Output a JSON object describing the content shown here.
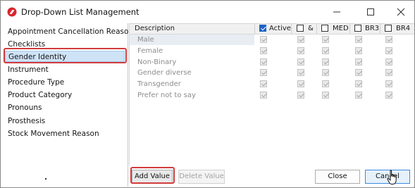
{
  "window": {
    "title": "Drop-Down List Management",
    "icon": "red-app-icon",
    "controls": [
      "minimize-icon",
      "maximize-icon",
      "close-icon"
    ]
  },
  "sidebar": {
    "items": [
      {
        "label": "Appointment Cancellation Reasons",
        "selected": false
      },
      {
        "label": "Checklists",
        "selected": false
      },
      {
        "label": "Gender Identity",
        "selected": true
      },
      {
        "label": "Instrument",
        "selected": false
      },
      {
        "label": "Procedure Type",
        "selected": false
      },
      {
        "label": "Product Category",
        "selected": false
      },
      {
        "label": "Pronouns",
        "selected": false
      },
      {
        "label": "Prosthesis",
        "selected": false
      },
      {
        "label": "Stock Movement Reason",
        "selected": false
      }
    ]
  },
  "grid": {
    "columns": [
      {
        "label": "Description",
        "checkbox": false
      },
      {
        "label": "Active",
        "checkbox": true,
        "checked": true
      },
      {
        "label": "&",
        "checkbox": true,
        "checked": false
      },
      {
        "label": "MED",
        "checkbox": true,
        "checked": false
      },
      {
        "label": "BR3",
        "checkbox": true,
        "checked": false
      },
      {
        "label": "BR4",
        "checkbox": true,
        "checked": false
      }
    ],
    "rows": [
      {
        "description": "Male",
        "checks": [
          true,
          true,
          true,
          true,
          true
        ]
      },
      {
        "description": "Female",
        "checks": [
          true,
          true,
          true,
          true,
          true
        ]
      },
      {
        "description": "Non-Binary",
        "checks": [
          true,
          true,
          true,
          true,
          true
        ]
      },
      {
        "description": "Gender diverse",
        "checks": [
          true,
          true,
          true,
          true,
          true
        ]
      },
      {
        "description": "Transgender",
        "checks": [
          true,
          true,
          true,
          true,
          true
        ]
      },
      {
        "description": "Prefer not to say",
        "checks": [
          true,
          true,
          true,
          true,
          true
        ]
      }
    ]
  },
  "buttons": {
    "add_value": "Add Value",
    "delete_value": "Delete Value",
    "close": "Close",
    "cancel": "Cancel"
  },
  "colors": {
    "accent": "#1e63c6",
    "highlight_outline": "#d23c3c",
    "selection": "#cfe3f7",
    "app_icon": "#d8262c"
  }
}
